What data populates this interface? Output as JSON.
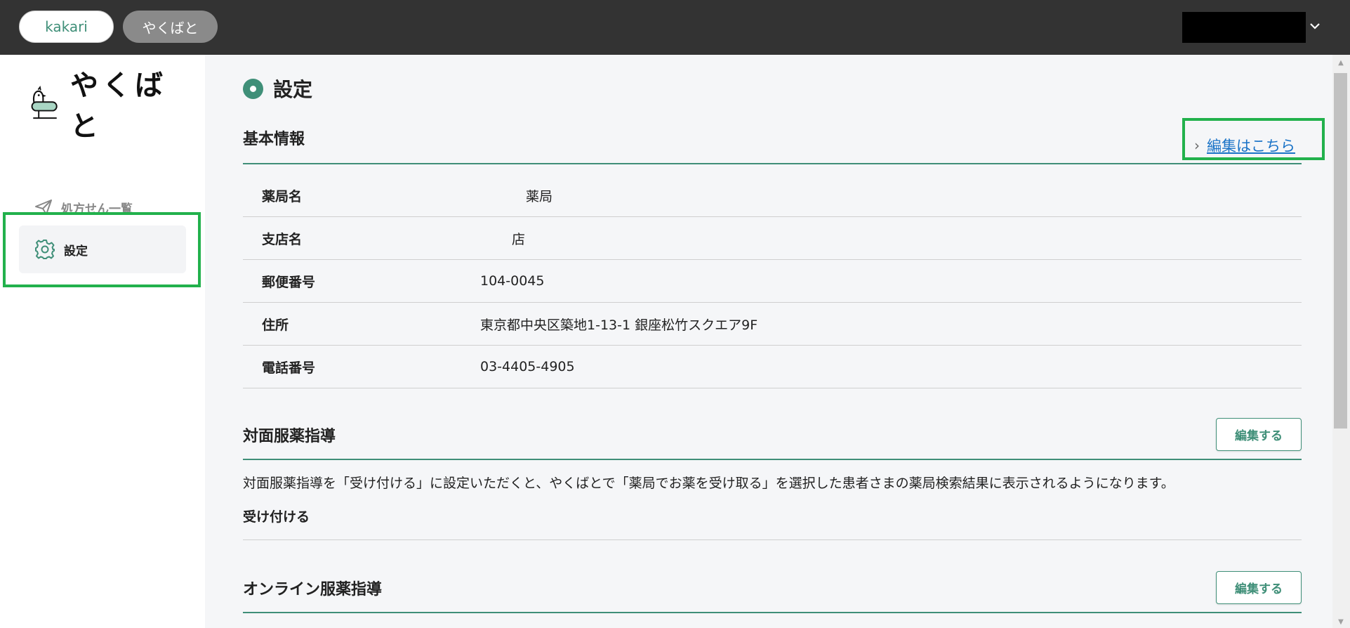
{
  "topbar": {
    "kakari_label": "kakari",
    "yakubato_label": "やくばと"
  },
  "sidebar": {
    "logo_text": "やくばと",
    "items": [
      {
        "label": "処方せん一覧"
      },
      {
        "label": "設定"
      }
    ]
  },
  "main": {
    "page_title": "設定",
    "basic": {
      "title": "基本情報",
      "edit_link": "編集はこちら",
      "rows": [
        {
          "label": "薬局名",
          "value": "薬局"
        },
        {
          "label": "支店名",
          "value": "店"
        },
        {
          "label": "郵便番号",
          "value": "104-0045"
        },
        {
          "label": "住所",
          "value": "東京都中央区築地1-13-1 銀座松竹スクエア9F"
        },
        {
          "label": "電話番号",
          "value": "03-4405-4905"
        }
      ]
    },
    "face_to_face": {
      "title": "対面服薬指導",
      "edit_button": "編集する",
      "description": "対面服薬指導を「受け付ける」に設定いただくと、やくばとで「薬局でお薬を受け取る」を選択した患者さまの薬局検索結果に表示されるようになります。",
      "status": "受け付ける"
    },
    "online": {
      "title": "オンライン服薬指導",
      "edit_button": "編集する"
    }
  },
  "colors": {
    "accent": "#3f8f78",
    "topbar": "#333333",
    "highlight": "#22b14c",
    "link": "#1a73c7"
  }
}
